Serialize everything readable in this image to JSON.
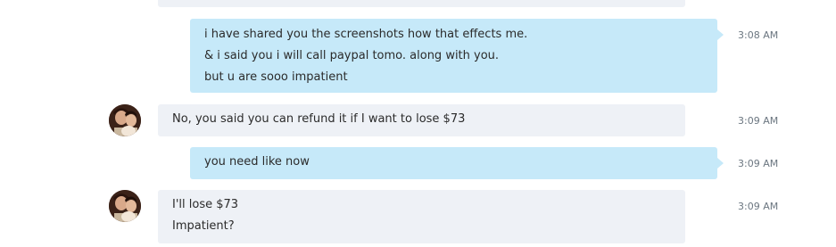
{
  "messages": [
    {
      "lines": []
    },
    {
      "lines": [
        "i have shared you the screenshots how that effects me.",
        "& i said you i will call paypal tomo. along with you.",
        "but u are sooo impatient"
      ],
      "time": "3:08 AM"
    },
    {
      "lines": [
        "No, you said you can refund it if I want to lose $73"
      ],
      "time": "3:09 AM"
    },
    {
      "lines": [
        "you need like now"
      ],
      "time": "3:09 AM"
    },
    {
      "lines": [
        "I'll lose $73",
        "Impatient?"
      ],
      "time": "3:09 AM"
    }
  ],
  "avatar_icon": "contact-avatar-photo",
  "colors": {
    "incoming_bubble": "#eef1f6",
    "outgoing_bubble": "#c6e9f9",
    "timestamp": "#6b7680",
    "text": "#2b2b2b"
  }
}
